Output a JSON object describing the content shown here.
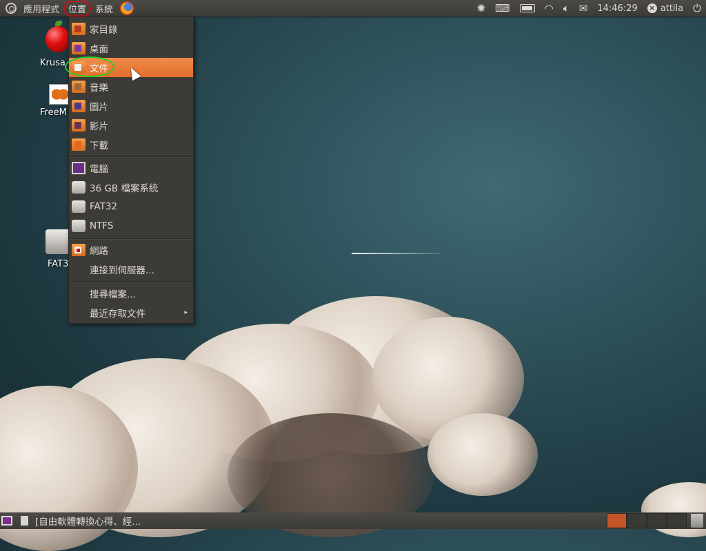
{
  "top_panel": {
    "applications_label": "應用程式",
    "places_label": "位置",
    "system_label": "系統",
    "clock": "14:46:29",
    "user": "attila",
    "tray_icons": [
      "ubuntu-one-icon",
      "keyboard-icon",
      "battery-icon",
      "wifi-icon",
      "volume-icon",
      "mail-icon"
    ]
  },
  "places_menu": {
    "items": [
      {
        "label": "家目錄",
        "icon": "home-folder-icon"
      },
      {
        "label": "桌面",
        "icon": "desktop-folder-icon"
      },
      {
        "label": "文件",
        "icon": "documents-folder-icon",
        "highlighted": true
      },
      {
        "label": "音樂",
        "icon": "music-folder-icon"
      },
      {
        "label": "圖片",
        "icon": "pictures-folder-icon"
      },
      {
        "label": "影片",
        "icon": "videos-folder-icon"
      },
      {
        "label": "下載",
        "icon": "downloads-folder-icon"
      },
      {
        "label": "電腦",
        "icon": "computer-icon"
      },
      {
        "label": "36 GB 檔案系統",
        "icon": "drive-icon"
      },
      {
        "label": "FAT32",
        "icon": "drive-icon"
      },
      {
        "label": "NTFS",
        "icon": "drive-icon"
      },
      {
        "label": "網路",
        "icon": "network-folder-icon"
      },
      {
        "label": "連接到伺服器...",
        "icon": ""
      },
      {
        "label": "搜尋檔案...",
        "icon": ""
      },
      {
        "label": "最近存取文件",
        "icon": "",
        "submenu": true
      }
    ]
  },
  "desktop_icons": [
    {
      "label": "Krusa",
      "icon": "apple-icon"
    },
    {
      "label": "FreeM",
      "icon": "butterfly-icon"
    },
    {
      "label": "FAT3",
      "icon": "hard-drive-icon"
    }
  ],
  "bottom_panel": {
    "task_label": "[自由軟體轉換心得、經...",
    "workspaces": 4,
    "active_workspace": 1
  },
  "colors": {
    "panel": "#3c3b37",
    "highlight": "#e36f2c",
    "annotation_red": "#c0141b",
    "annotation_green": "#1fd41f"
  }
}
